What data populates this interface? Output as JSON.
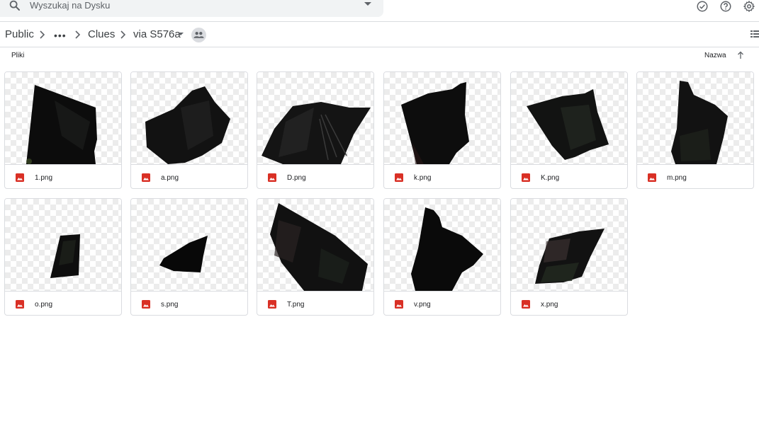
{
  "search": {
    "placeholder": "Wyszukaj na Dysku"
  },
  "header_icons": [
    "offline-check-icon",
    "help-icon",
    "settings-gear-icon"
  ],
  "breadcrumb": {
    "items": [
      "Public",
      "Clues",
      "via S576a"
    ],
    "more_label": "•••"
  },
  "section": {
    "label": "Pliki",
    "sort_label": "Nazwa"
  },
  "colors": {
    "accent_red": "#d93025",
    "border": "#dadce0",
    "text": "#202124"
  },
  "files": [
    {
      "name": "1.png"
    },
    {
      "name": "a.png"
    },
    {
      "name": "D.png"
    },
    {
      "name": "k.png"
    },
    {
      "name": "K.png"
    },
    {
      "name": "m.png"
    },
    {
      "name": "o.png"
    },
    {
      "name": "s.png"
    },
    {
      "name": "T.png"
    },
    {
      "name": "v.png"
    },
    {
      "name": "x.png"
    }
  ]
}
